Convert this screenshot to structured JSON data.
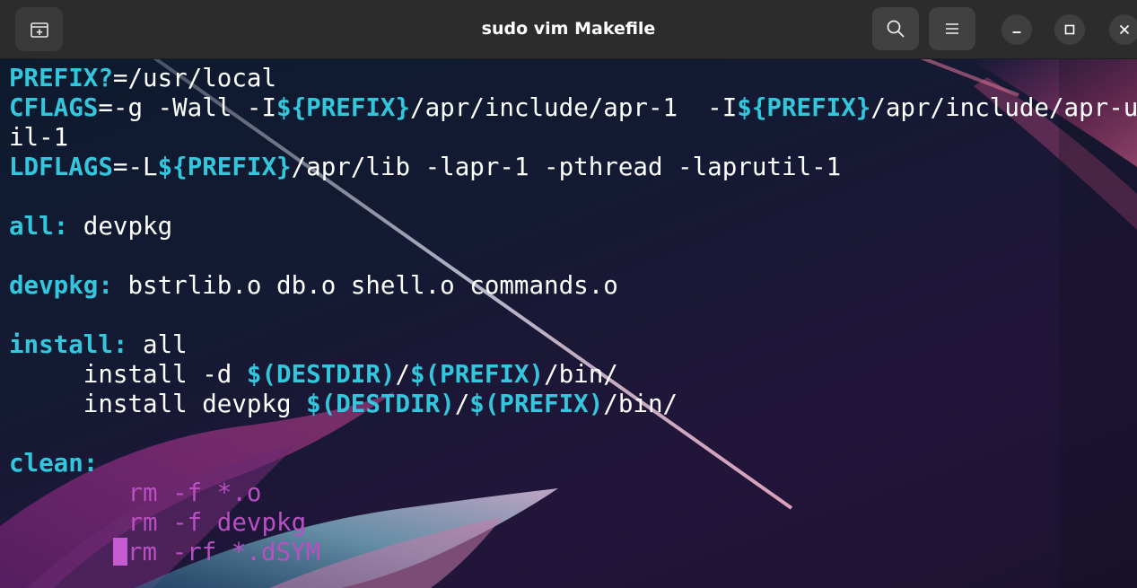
{
  "window": {
    "title": "sudo vim Makefile"
  },
  "header": {
    "buttons": [
      {
        "name": "new-tab-button",
        "icon": "new-tab-icon"
      },
      {
        "name": "search-button",
        "icon": "search-icon"
      },
      {
        "name": "menu-button",
        "icon": "hamburger-menu-icon"
      },
      {
        "name": "minimize-button",
        "icon": "minimize-icon"
      },
      {
        "name": "maximize-button",
        "icon": "maximize-icon"
      },
      {
        "name": "close-button",
        "icon": "close-icon"
      }
    ]
  },
  "editor": {
    "colors": {
      "keyword": "#33c7de",
      "recipe": "#b84fc2",
      "cursor": "#c45bd0",
      "text": "#ffffff"
    },
    "lines": [
      [
        {
          "t": "PREFIX?",
          "c": "kw"
        },
        {
          "t": "=/usr/local",
          "c": ""
        }
      ],
      [
        {
          "t": "CFLAGS",
          "c": "kw"
        },
        {
          "t": "=-g -Wall -I",
          "c": ""
        },
        {
          "t": "${PREFIX}",
          "c": "var"
        },
        {
          "t": "/apr/include/apr-1  -I",
          "c": ""
        },
        {
          "t": "${PREFIX}",
          "c": "var"
        },
        {
          "t": "/apr/include/apr-u",
          "c": ""
        }
      ],
      [
        {
          "t": "il-1",
          "c": ""
        }
      ],
      [
        {
          "t": "LDFLAGS",
          "c": "kw"
        },
        {
          "t": "=-L",
          "c": ""
        },
        {
          "t": "${PREFIX}",
          "c": "var"
        },
        {
          "t": "/apr/lib -lapr-1 -pthread -laprutil-1",
          "c": ""
        }
      ],
      [],
      [
        {
          "t": "all:",
          "c": "kw"
        },
        {
          "t": " devpkg",
          "c": ""
        }
      ],
      [],
      [
        {
          "t": "devpkg:",
          "c": "kw"
        },
        {
          "t": " bstrlib.o db.o shell.o commands.o",
          "c": ""
        }
      ],
      [],
      [
        {
          "t": "install:",
          "c": "kw"
        },
        {
          "t": " all",
          "c": ""
        }
      ],
      [
        {
          "t": "     install -d ",
          "c": ""
        },
        {
          "t": "$(DESTDIR)",
          "c": "var"
        },
        {
          "t": "/",
          "c": ""
        },
        {
          "t": "$(PREFIX)",
          "c": "var"
        },
        {
          "t": "/bin/",
          "c": ""
        }
      ],
      [
        {
          "t": "     install devpkg ",
          "c": ""
        },
        {
          "t": "$(DESTDIR)",
          "c": "var"
        },
        {
          "t": "/",
          "c": ""
        },
        {
          "t": "$(PREFIX)",
          "c": "var"
        },
        {
          "t": "/bin/",
          "c": ""
        }
      ],
      [],
      [
        {
          "t": "clean:",
          "c": "kw"
        }
      ],
      [
        {
          "t": "        ",
          "c": ""
        },
        {
          "t": "rm -f *.o",
          "c": "purple"
        }
      ],
      [
        {
          "t": "        ",
          "c": ""
        },
        {
          "t": "rm -f devpkg",
          "c": "purple"
        }
      ],
      [
        {
          "t": "       ",
          "c": ""
        },
        {
          "t": "",
          "c": "cursor"
        },
        {
          "t": "rm -rf *.dSYM",
          "c": "purple"
        }
      ]
    ]
  }
}
